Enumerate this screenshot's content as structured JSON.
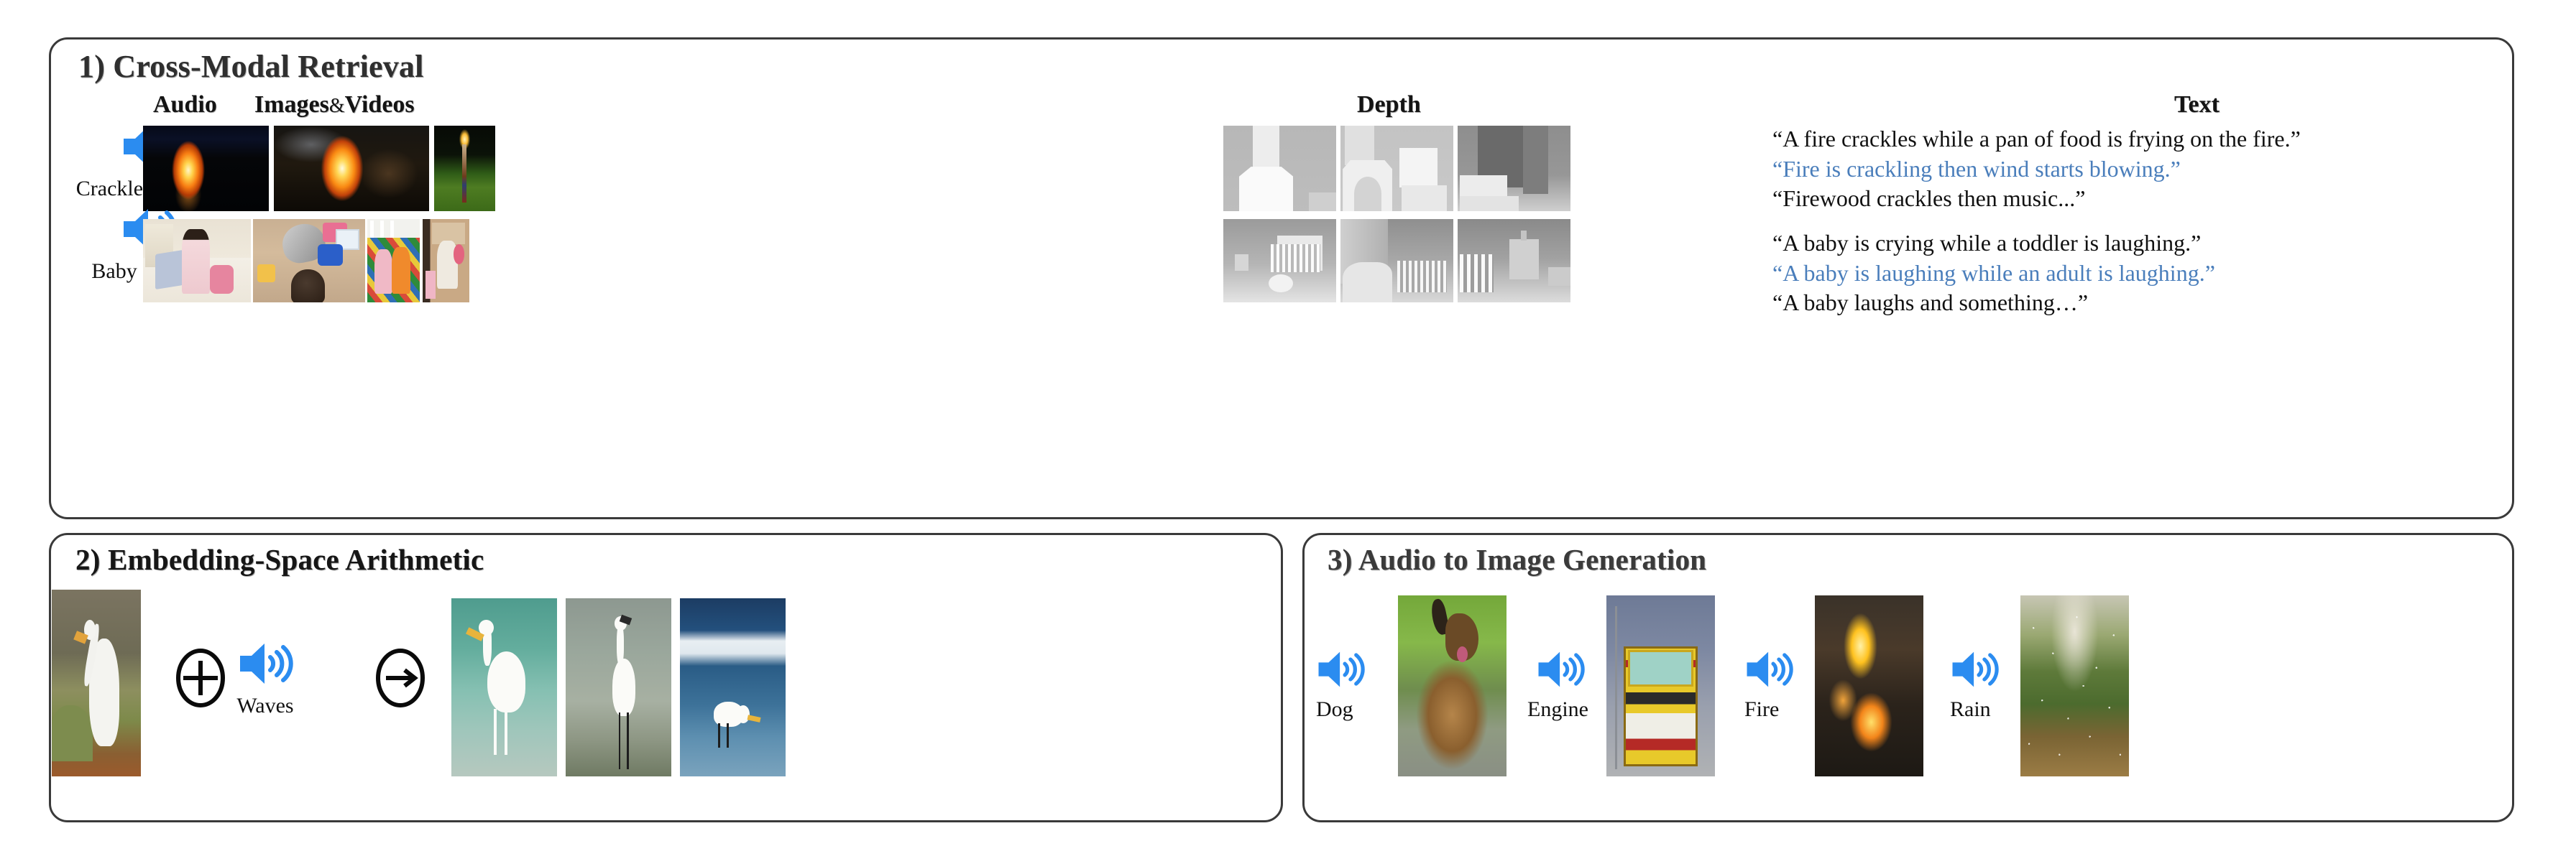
{
  "panels": [
    {
      "id": "p1",
      "title": "1) Cross-Modal Retrieval",
      "columns": [
        {
          "label": "Audio"
        },
        {
          "label_main": "Images",
          "amp": "&",
          "label_tail": "Videos"
        },
        {
          "label": "Depth"
        },
        {
          "label": "Text"
        }
      ],
      "rows": [
        {
          "audio": {
            "icon": "speaker-icon",
            "label": "Crackle of a Fire"
          },
          "images": [
            "fire-reflection-night",
            "bonfire-with-people",
            "burning-effigy-in-grass"
          ],
          "depth": [
            "depth-fireplace-room",
            "depth-fireplace-with-sofa",
            "depth-dark-room-table"
          ],
          "text": [
            {
              "value": "“A fire crackles while a pan of food is frying on the fire.”",
              "highlight": false
            },
            {
              "value": "“Fire is crackling then wind starts blowing.”",
              "highlight": true
            },
            {
              "value": "“Firewood crackles then music...”",
              "highlight": false
            }
          ]
        },
        {
          "audio": {
            "icon": "speaker-icon",
            "label": "Baby Cooing"
          },
          "images": [
            "baby-sitting-on-mat",
            "babies-playing-with-toys",
            "two-babies-in-crib",
            "baby-with-plush-toys"
          ],
          "depth": [
            "depth-nursery-with-crib",
            "depth-curtain-and-crib",
            "depth-crib-and-dresser"
          ],
          "text": [
            {
              "value": "“A baby is crying while a toddler is laughing.”",
              "highlight": false
            },
            {
              "value": "“A baby is laughing while an adult is laughing.”",
              "highlight": true
            },
            {
              "value": "“A baby laughs and something…”",
              "highlight": false
            }
          ]
        }
      ]
    },
    {
      "id": "p2",
      "title": "2) Embedding-Space Arithmetic",
      "source_image": "egret-in-grassland",
      "operators": [
        {
          "name": "plus-circle-icon",
          "symbol": "+"
        },
        {
          "name": "arrow-right-circle-icon",
          "symbol": "→"
        }
      ],
      "audio": {
        "icon": "speaker-icon",
        "label": "Waves"
      },
      "results": [
        "egret-in-turquoise-water",
        "egret-on-mudflat",
        "egret-in-surf"
      ]
    },
    {
      "id": "p3",
      "title": "3) Audio to Image Generation",
      "items": [
        {
          "icon": "speaker-icon",
          "label": "Dog",
          "image": "generated-german-shepherd"
        },
        {
          "icon": "speaker-icon",
          "label": "Engine",
          "image": "generated-bus-front"
        },
        {
          "icon": "speaker-icon",
          "label": "Fire",
          "image": "generated-campfire"
        },
        {
          "icon": "speaker-icon",
          "label": "Rain",
          "image": "generated-rainy-forest"
        }
      ]
    }
  ],
  "colors": {
    "speaker_blue": "#2b8cf0",
    "highlight_text_blue": "#4a7ebb",
    "panel_border": "#3a3a3a",
    "title_text": "#2f2f2f",
    "body_text": "#111111"
  }
}
